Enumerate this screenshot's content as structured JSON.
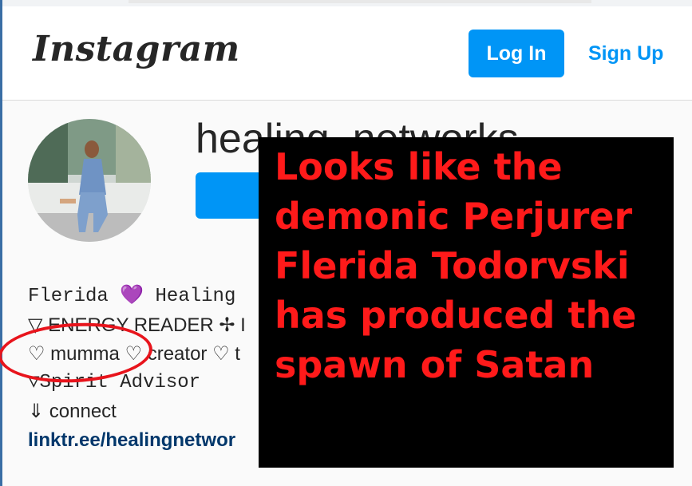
{
  "header": {
    "logo_text": "Instagram",
    "login_label": "Log In",
    "signup_label": "Sign Up"
  },
  "profile": {
    "username": "healing_networks",
    "bio": {
      "name_line_part1": "Flerida",
      "name_emoji": "💜",
      "name_line_part2": "Healing",
      "line2": "▽ ENERGY READER ✢ I",
      "line3_part1": "♡ mumma",
      "line3_part2": "♡ creator ♡ t",
      "line4": "▽Spirit Advisor",
      "line5": "⇓ connect",
      "link": "linktr.ee/healingnetwor"
    }
  },
  "overlay": {
    "text": "Looks like the demonic Perjurer Flerida Todorvski has produced the spawn of Satan"
  },
  "colors": {
    "accent": "#0095f6",
    "overlay_bg": "#000000",
    "overlay_text": "#ff1a1a",
    "circle": "#e8141c"
  },
  "icons": {
    "heart": "purple-heart-icon"
  }
}
